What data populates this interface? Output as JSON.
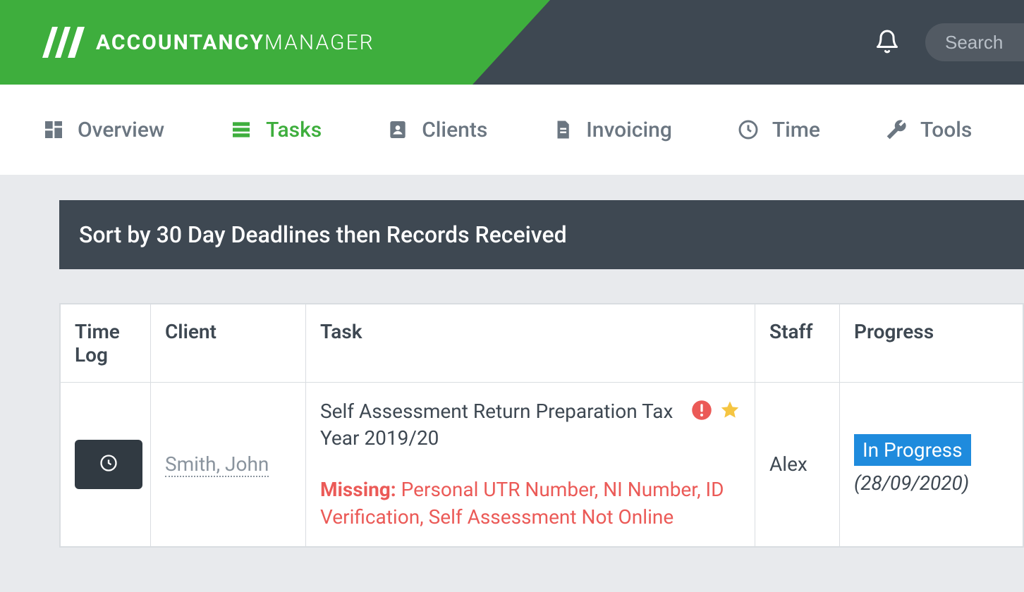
{
  "brand": {
    "name_bold": "ACCOUNTANCY",
    "name_light": "MANAGER"
  },
  "search": {
    "placeholder": "Search"
  },
  "nav": {
    "items": [
      {
        "label": "Overview"
      },
      {
        "label": "Tasks"
      },
      {
        "label": "Clients"
      },
      {
        "label": "Invoicing"
      },
      {
        "label": "Time"
      },
      {
        "label": "Tools"
      }
    ],
    "active_index": 1
  },
  "section": {
    "title": "Sort by 30 Day Deadlines then Records Received"
  },
  "table": {
    "headers": {
      "time_log": "Time Log",
      "client": "Client",
      "task": "Task",
      "staff": "Staff",
      "progress": "Progress"
    },
    "rows": [
      {
        "client": "Smith, John",
        "task_title": "Self Assessment Return Preparation Tax Year 2019/20",
        "missing_label": "Missing:",
        "missing_text": "Personal UTR Number, NI Number, ID Verification, Self Assessment Not Online",
        "staff": "Alex",
        "progress_status": "In Progress",
        "progress_date": "(28/09/2020)"
      }
    ]
  },
  "colors": {
    "green": "#3eae3d",
    "dark": "#3e4852",
    "blue": "#1f8bdd",
    "red": "#eb5a57",
    "star": "#f5c542"
  }
}
